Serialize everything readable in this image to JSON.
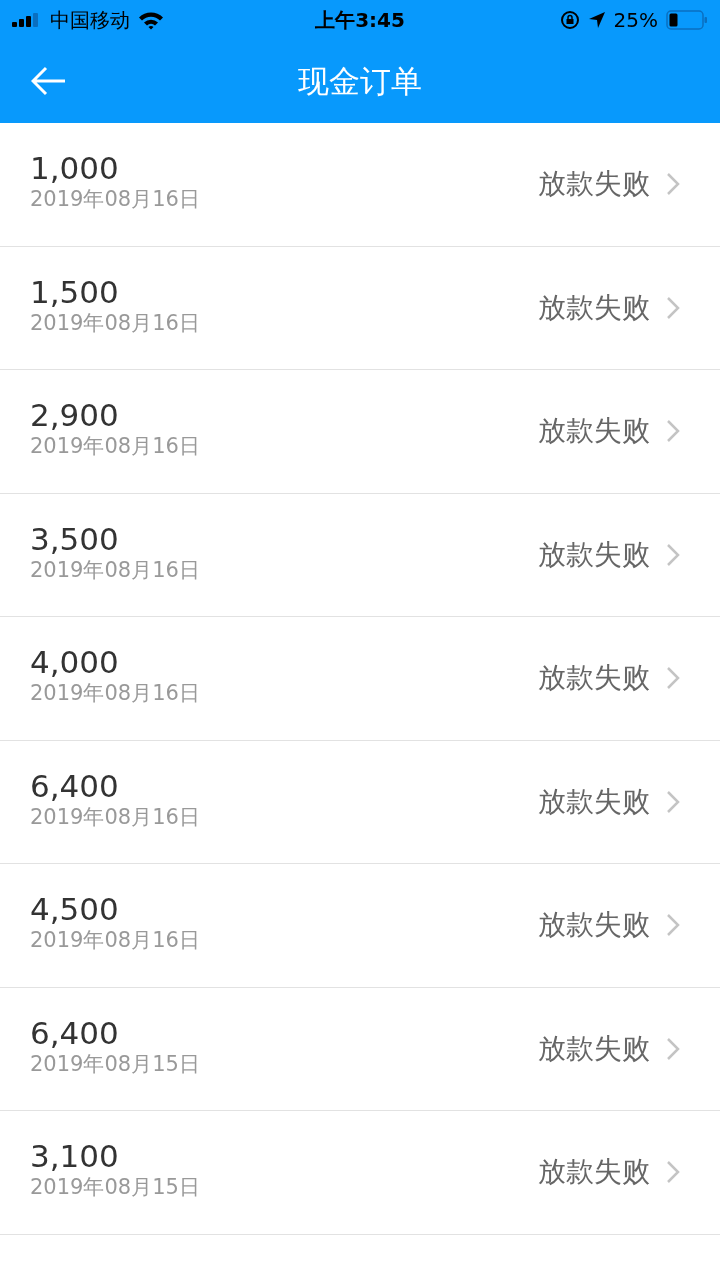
{
  "status_bar": {
    "carrier": "中国移动",
    "time": "上午3:45",
    "battery": "25%"
  },
  "nav_bar": {
    "title": "现金订单"
  },
  "orders": [
    {
      "amount": "1,000",
      "date": "2019年08月16日",
      "status": "放款失败"
    },
    {
      "amount": "1,500",
      "date": "2019年08月16日",
      "status": "放款失败"
    },
    {
      "amount": "2,900",
      "date": "2019年08月16日",
      "status": "放款失败"
    },
    {
      "amount": "3,500",
      "date": "2019年08月16日",
      "status": "放款失败"
    },
    {
      "amount": "4,000",
      "date": "2019年08月16日",
      "status": "放款失败"
    },
    {
      "amount": "6,400",
      "date": "2019年08月16日",
      "status": "放款失败"
    },
    {
      "amount": "4,500",
      "date": "2019年08月16日",
      "status": "放款失败"
    },
    {
      "amount": "6,400",
      "date": "2019年08月15日",
      "status": "放款失败"
    },
    {
      "amount": "3,100",
      "date": "2019年08月15日",
      "status": "放款失败"
    }
  ]
}
